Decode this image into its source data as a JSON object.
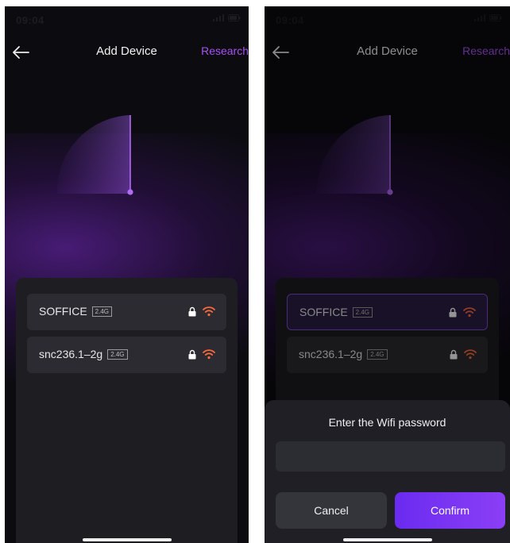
{
  "left": {
    "status": {
      "time": "09:04"
    },
    "nav": {
      "title": "Add Device",
      "action": "Research"
    },
    "networks": [
      {
        "ssid": "SOFFICE",
        "band": "2.4G"
      },
      {
        "ssid": "snc236.1–2g",
        "band": "2.4G"
      }
    ]
  },
  "right": {
    "status": {
      "time": "09:04"
    },
    "nav": {
      "title": "Add Device",
      "action": "Research"
    },
    "networks": [
      {
        "ssid": "SOFFICE",
        "band": "2.4G",
        "selected": true
      },
      {
        "ssid": "snc236.1–2g",
        "band": "2.4G"
      }
    ],
    "dialog": {
      "title": "Enter the Wifi password",
      "password_value": "",
      "cancel_label": "Cancel",
      "confirm_label": "Confirm"
    }
  },
  "icons": {
    "back": "arrow-left-icon",
    "lock": "lock-icon",
    "wifi": "wifi-icon",
    "radar": "radar-sweep-icon"
  },
  "colors": {
    "accent": "#a552f0",
    "wifi_signal": "#ff6a3d",
    "confirm_start": "#6a2bf0",
    "confirm_end": "#8b3ff5",
    "background": "#0c0c10"
  }
}
